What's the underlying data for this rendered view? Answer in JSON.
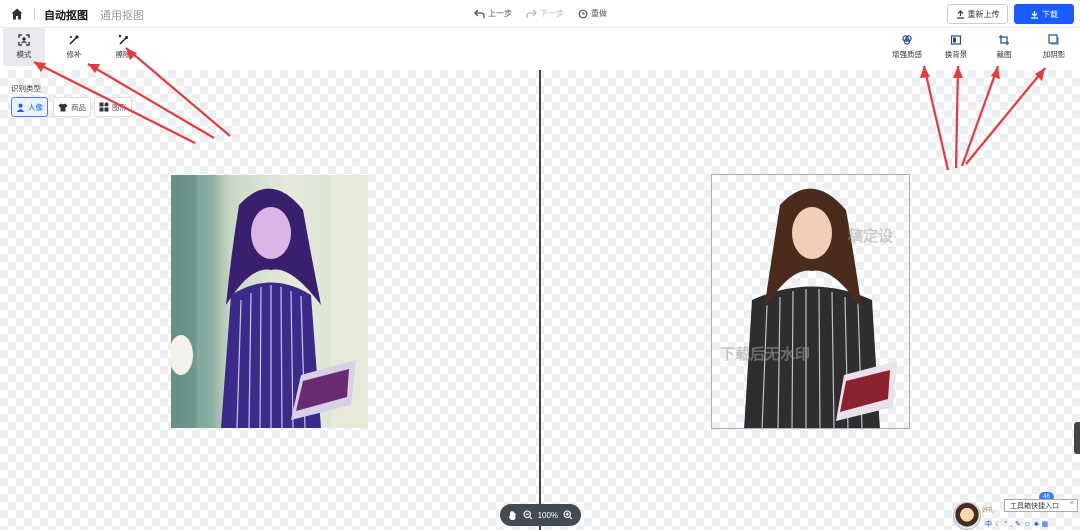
{
  "header": {
    "tab_active": "自动抠图",
    "tab_inactive": "通用抠图",
    "undo_label": "上一步",
    "redo_label": "下一步",
    "reset_label": "重做",
    "reupload_label": "重新上传",
    "download_label": "下载",
    "accent_color": "#1a5cff"
  },
  "left_tools": [
    {
      "label": "模式",
      "icon": "select-mode-icon"
    },
    {
      "label": "修补",
      "icon": "repair-brush-icon"
    },
    {
      "label": "擦除",
      "icon": "eraser-wand-icon"
    }
  ],
  "right_tools": [
    {
      "label": "增强质感",
      "icon": "enhance-icon"
    },
    {
      "label": "换背景",
      "icon": "change-background-icon"
    },
    {
      "label": "裁图",
      "icon": "crop-icon"
    },
    {
      "label": "加阴影",
      "icon": "shadow-icon"
    }
  ],
  "recognition": {
    "title": "识别类型",
    "chips": [
      {
        "label": "人像",
        "icon": "person-icon",
        "active": true
      },
      {
        "label": "商品",
        "icon": "shirt-icon",
        "active": false
      },
      {
        "label": "图形",
        "icon": "shapes-icon",
        "active": false
      }
    ]
  },
  "preview": {
    "watermark_text": "下载后无水印",
    "watermark_text_2": "稿定设"
  },
  "zoom": {
    "level": "100%"
  },
  "system_tray": {
    "tip_label": "工具箱快捷入口",
    "tray_text": "中",
    "badge": "46",
    "note": "好礼"
  }
}
